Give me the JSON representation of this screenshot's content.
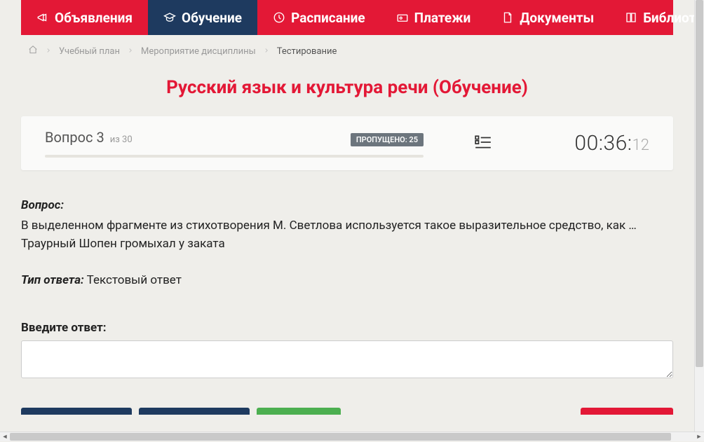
{
  "nav": {
    "items": [
      {
        "label": "Объявления",
        "icon": "megaphone-icon"
      },
      {
        "label": "Обучение",
        "icon": "cap-icon",
        "active": true
      },
      {
        "label": "Расписание",
        "icon": "clock-icon"
      },
      {
        "label": "Платежи",
        "icon": "payment-icon"
      },
      {
        "label": "Документы",
        "icon": "document-icon"
      },
      {
        "label": "Библиотека",
        "icon": "book-icon",
        "dropdown": true
      }
    ]
  },
  "breadcrumb": {
    "items": [
      {
        "label": "Учебный план",
        "link": true
      },
      {
        "label": "Мероприятие дисциплины",
        "link": true
      },
      {
        "label": "Тестирование",
        "link": false
      }
    ]
  },
  "page": {
    "title": "Русский язык и культура речи (Обучение)"
  },
  "question_header": {
    "question_label": "Вопрос 3",
    "of_label": "из 30",
    "skipped_badge": "ПРОПУЩЕНО: 25",
    "timer_main": "00:36:",
    "timer_seconds": "12"
  },
  "question": {
    "label": "Вопрос:",
    "text_line1": "В выделенном фрагменте из стихотворения М. Светлова используется такое выразительное средство, как …",
    "text_line2": "Траурный Шопен громыхал у заката",
    "answer_type_label": "Тип ответа:",
    "answer_type_value": "Текстовый ответ",
    "input_label": "Введите ответ:",
    "input_value": ""
  }
}
